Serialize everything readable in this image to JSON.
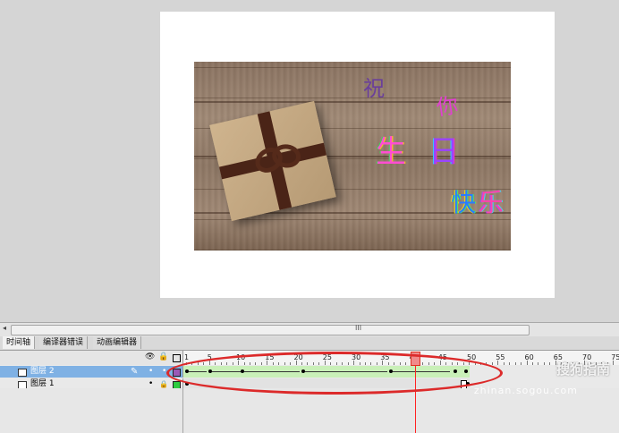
{
  "stage": {
    "scroll_grip": "III",
    "greeting": [
      "祝",
      "你",
      "生",
      "日",
      "快",
      "乐"
    ]
  },
  "timeline": {
    "tabs": [
      "时间轴",
      "编译器错误",
      "动画编辑器"
    ],
    "active_tab": "时间轴",
    "ruler_numbers": [
      "1",
      "5",
      "10",
      "15",
      "20",
      "25",
      "30",
      "35",
      "40",
      "45",
      "50",
      "55",
      "60",
      "65",
      "70",
      "75"
    ],
    "current_frame": "40",
    "layers": [
      {
        "name": "图层 2",
        "selected": true,
        "color": "#9b59b6"
      },
      {
        "name": "图层 1",
        "selected": false,
        "color": "#2ecc40"
      }
    ]
  },
  "watermark": {
    "text": "搜狗指南",
    "url": "zhinan.sogou.com"
  }
}
